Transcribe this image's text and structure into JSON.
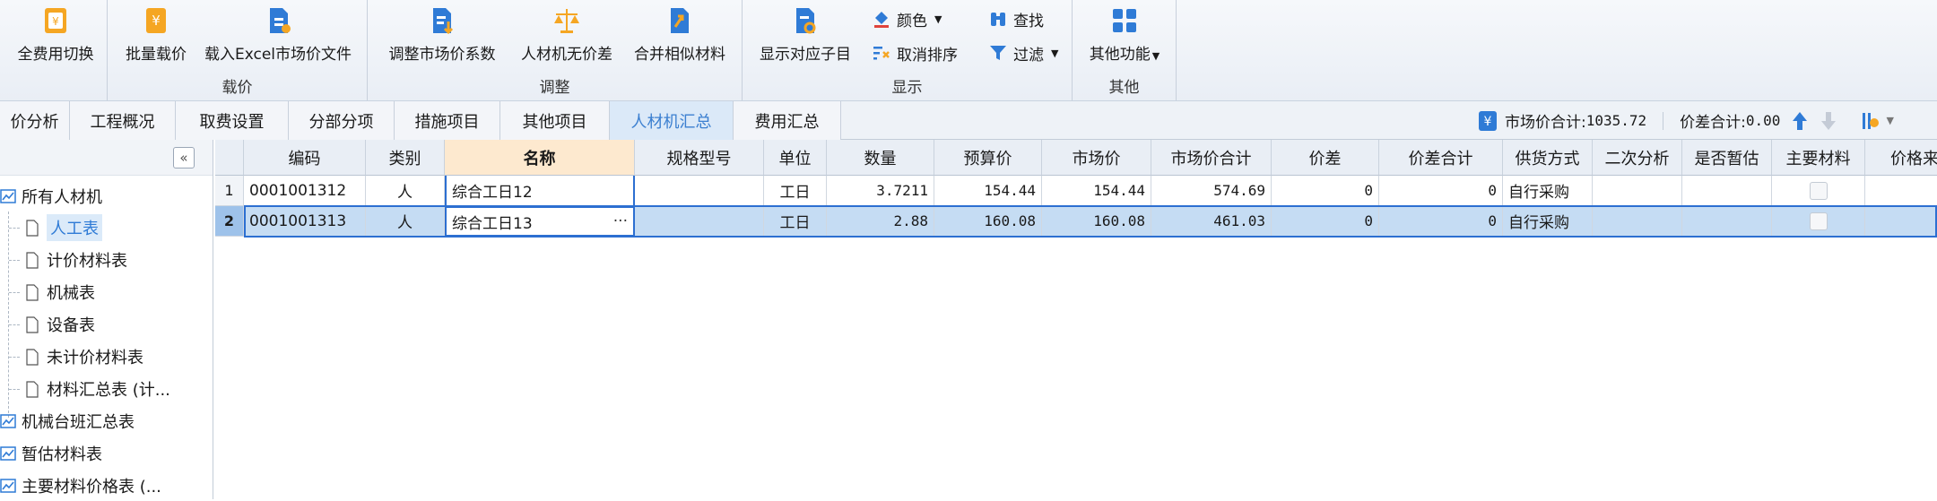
{
  "ribbon": {
    "buttons": {
      "full_cost_switch": "全费用切换",
      "batch_price": "批量载价",
      "load_excel": "载入Excel市场价文件",
      "adjust_factor": "调整市场价系数",
      "no_price_diff": "人材机无价差",
      "merge_similar": "合并相似材料",
      "show_sub_items": "显示对应子目",
      "color": "颜色",
      "find": "查找",
      "cancel_sort": "取消排序",
      "filter": "过滤",
      "other_functions": "其他功能"
    },
    "groups": {
      "load_price": "载价",
      "adjust": "调整",
      "display": "显示",
      "other": "其他"
    }
  },
  "tabs": [
    {
      "label": "价分析"
    },
    {
      "label": "工程概况"
    },
    {
      "label": "取费设置"
    },
    {
      "label": "分部分项"
    },
    {
      "label": "措施项目"
    },
    {
      "label": "其他项目"
    },
    {
      "label": "人材机汇总",
      "active": true
    },
    {
      "label": "费用汇总"
    }
  ],
  "summary": {
    "market_total_label": "市场价合计:",
    "market_total_value": "1035.72",
    "diff_total_label": "价差合计:",
    "diff_total_value": "0.00"
  },
  "tree": {
    "root": "所有人材机",
    "children": [
      "人工表",
      "计价材料表",
      "机械表",
      "设备表",
      "未计价材料表",
      "材料汇总表 (计..."
    ],
    "others": [
      "机械台班汇总表",
      "暂估材料表",
      "主要材料价格表 (..."
    ]
  },
  "grid": {
    "columns": [
      "编码",
      "类别",
      "名称",
      "规格型号",
      "单位",
      "数量",
      "预算价",
      "市场价",
      "市场价合计",
      "价差",
      "价差合计",
      "供货方式",
      "二次分析",
      "是否暂估",
      "主要材料",
      "价格来"
    ],
    "rows": [
      {
        "num": "1",
        "code": "0001001312",
        "type": "人",
        "name": "综合工日12",
        "spec": "",
        "unit": "工日",
        "qty": "3.7211",
        "budget": "154.44",
        "market": "154.44",
        "market_total": "574.69",
        "diff": "0",
        "diff_total": "0",
        "supply": "自行采购"
      },
      {
        "num": "2",
        "code": "0001001313",
        "type": "人",
        "name": "综合工日13",
        "spec": "",
        "unit": "工日",
        "qty": "2.88",
        "budget": "160.08",
        "market": "160.08",
        "market_total": "461.03",
        "diff": "0",
        "diff_total": "0",
        "supply": "自行采购"
      }
    ],
    "ellipsis": "···"
  },
  "colors": {
    "accent": "#2c6fd1",
    "active_tab_text": "#3b7fd0",
    "selected_row": "#c5dcf3",
    "name_header": "#fde9cf"
  }
}
